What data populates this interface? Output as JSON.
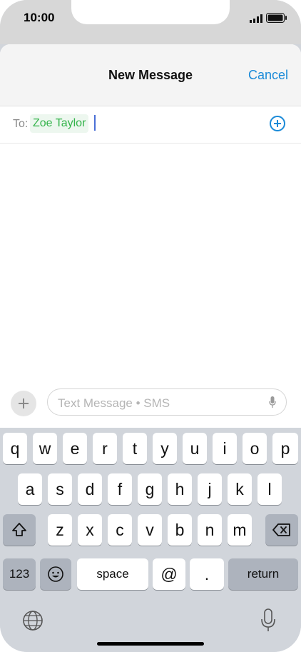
{
  "status_bar": {
    "time": "10:00"
  },
  "header": {
    "title": "New Message",
    "cancel_label": "Cancel"
  },
  "recipient": {
    "to_label": "To:",
    "name": "Zoe Taylor"
  },
  "compose": {
    "placeholder": "Text Message • SMS"
  },
  "keyboard": {
    "row1": [
      "q",
      "w",
      "e",
      "r",
      "t",
      "y",
      "u",
      "i",
      "o",
      "p"
    ],
    "row2": [
      "a",
      "s",
      "d",
      "f",
      "g",
      "h",
      "j",
      "k",
      "l"
    ],
    "row3": [
      "z",
      "x",
      "c",
      "v",
      "b",
      "n",
      "m"
    ],
    "numbers_label": "123",
    "space_label": "space",
    "at_label": "@",
    "period_label": ".",
    "return_label": "return"
  },
  "colors": {
    "accent": "#1a8ad8",
    "recipient_green": "#33b34a",
    "keyboard_bg": "#d1d5db"
  },
  "icons": [
    "signal-icon",
    "battery-icon",
    "add-recipient-icon",
    "plus-icon",
    "microphone-icon",
    "shift-icon",
    "delete-icon",
    "emoji-icon",
    "globe-icon",
    "dictation-microphone-icon"
  ]
}
